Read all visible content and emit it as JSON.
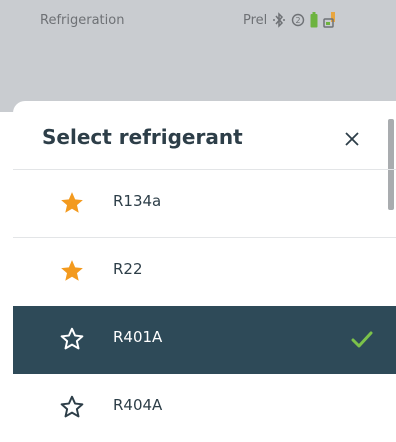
{
  "statusbar": {
    "title": "Refrigeration",
    "mode": "Prel",
    "icons": [
      "bluetooth-icon",
      "info-icon",
      "battery-icon",
      "probe-icon"
    ]
  },
  "dialog": {
    "title": "Select refrigerant",
    "close_icon": "close-icon"
  },
  "refrigerants": [
    {
      "name": "R134a",
      "favorite": true,
      "selected": false
    },
    {
      "name": "R22",
      "favorite": true,
      "selected": false
    },
    {
      "name": "R401A",
      "favorite": false,
      "selected": true
    },
    {
      "name": "R404A",
      "favorite": false,
      "selected": false
    }
  ],
  "colors": {
    "favorite_star": "#f39a1e",
    "selected_row": "#2e4a58",
    "check": "#7cc24a",
    "statusbar_bg": "#c9ccd0",
    "text": "#2d3e48"
  }
}
